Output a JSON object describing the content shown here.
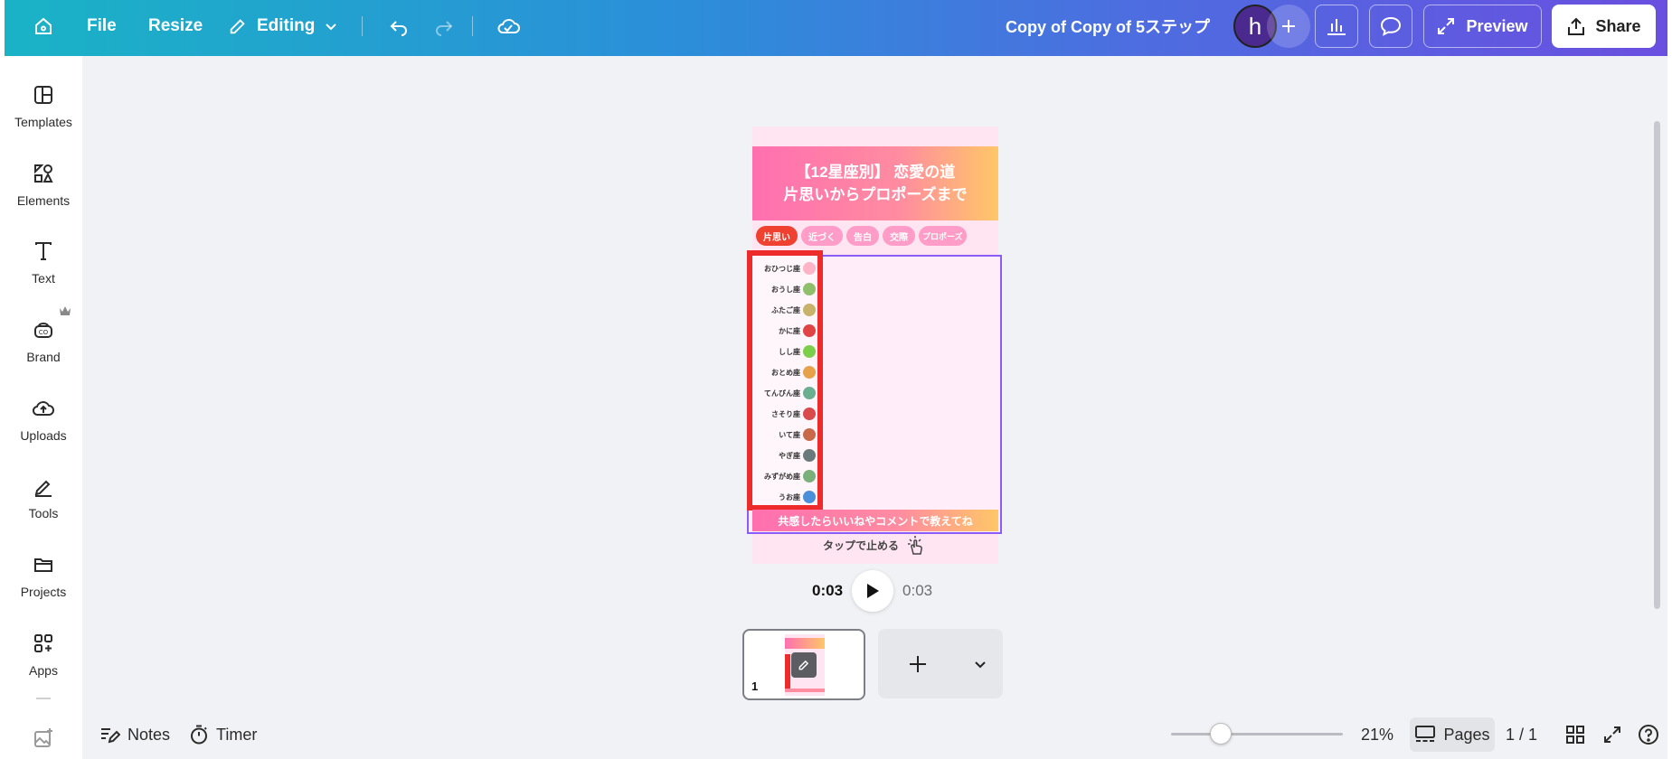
{
  "topbar": {
    "file_label": "File",
    "resize_label": "Resize",
    "editing_label": "Editing",
    "document_title": "Copy of Copy of 5ステップ",
    "avatar_initial": "h",
    "preview_label": "Preview",
    "share_label": "Share",
    "gradient_start": "#1ab3c6",
    "gradient_end": "#6a4fe0"
  },
  "sidebar": {
    "items": [
      {
        "label": "Templates",
        "icon": "templates-icon"
      },
      {
        "label": "Elements",
        "icon": "elements-icon"
      },
      {
        "label": "Text",
        "icon": "text-icon"
      },
      {
        "label": "Brand",
        "icon": "brand-icon"
      },
      {
        "label": "Uploads",
        "icon": "uploads-icon"
      },
      {
        "label": "Tools",
        "icon": "tools-icon"
      },
      {
        "label": "Projects",
        "icon": "projects-icon"
      },
      {
        "label": "Apps",
        "icon": "apps-icon"
      }
    ]
  },
  "design": {
    "title_line1": "【12星座別】 恋愛の道",
    "title_line2": "片思いからプロポーズまで",
    "steps": [
      "片思い",
      "近づく",
      "告白",
      "交際",
      "プロポーズ"
    ],
    "signs": [
      "おひつじ座",
      "おうし座",
      "ふたご座",
      "かに座",
      "しし座",
      "おとめ座",
      "てんびん座",
      "さそり座",
      "いて座",
      "やぎ座",
      "みずがめ座",
      "うお座"
    ],
    "sign_colors": [
      "#ffb3c6",
      "#8fbf6a",
      "#c8b26a",
      "#e04444",
      "#7ccf4a",
      "#e6a24b",
      "#6aaf8f",
      "#d94a4a",
      "#c86a4a",
      "#6a7a7a",
      "#7ab07a",
      "#4a8fd9"
    ],
    "bottom_text": "共感したらいいねやコメントで教えてね",
    "tap_text": "タップで止める",
    "selection_color": "#8b5cf6",
    "highlight_color": "#ee2b2b"
  },
  "playback": {
    "current_time": "0:03",
    "total_time": "0:03"
  },
  "thumbnails": {
    "page_number": "1"
  },
  "bottombar": {
    "notes_label": "Notes",
    "timer_label": "Timer",
    "zoom_value": "21%",
    "zoom_level": 0.21,
    "pages_label": "Pages",
    "page_count": "1 / 1"
  }
}
